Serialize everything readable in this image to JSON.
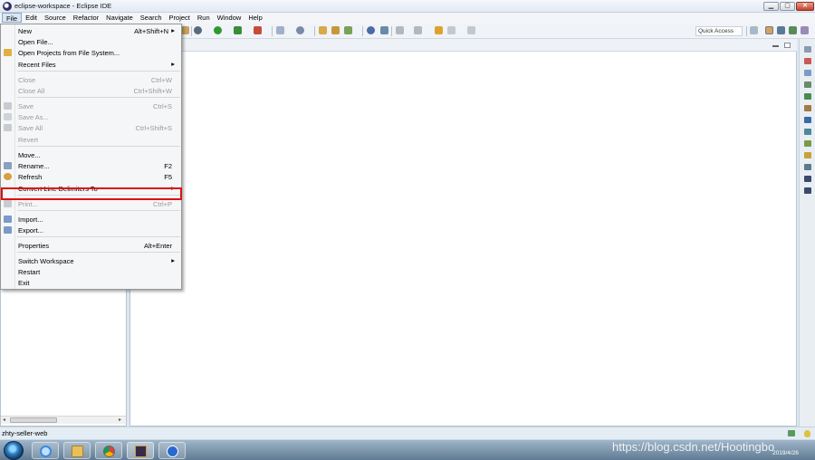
{
  "window": {
    "title": "eclipse-workspace - Eclipse IDE",
    "controls": {
      "minimize": "▁",
      "maximize": "▢",
      "close": "✕"
    }
  },
  "menubar": [
    "File",
    "Edit",
    "Source",
    "Refactor",
    "Navigate",
    "Search",
    "Project",
    "Run",
    "Window",
    "Help"
  ],
  "toolbar": {
    "quick_access": "Quick Access"
  },
  "file_menu": {
    "items": [
      {
        "label": "New",
        "shortcut": "Alt+Shift+N",
        "submenu": true,
        "enabled": true,
        "icon": ""
      },
      {
        "label": "Open File...",
        "shortcut": "",
        "submenu": false,
        "enabled": true,
        "icon": ""
      },
      {
        "label": "Open Projects from File System...",
        "shortcut": "",
        "submenu": false,
        "enabled": true,
        "icon": "folder-icon"
      },
      {
        "label": "Recent Files",
        "shortcut": "",
        "submenu": true,
        "enabled": true,
        "icon": ""
      },
      {
        "label": "Close",
        "shortcut": "Ctrl+W",
        "submenu": false,
        "enabled": false,
        "icon": ""
      },
      {
        "label": "Close All",
        "shortcut": "Ctrl+Shift+W",
        "submenu": false,
        "enabled": false,
        "icon": ""
      },
      {
        "label": "Save",
        "shortcut": "Ctrl+S",
        "submenu": false,
        "enabled": false,
        "icon": "save-icon"
      },
      {
        "label": "Save As...",
        "shortcut": "",
        "submenu": false,
        "enabled": false,
        "icon": "save-as-icon"
      },
      {
        "label": "Save All",
        "shortcut": "Ctrl+Shift+S",
        "submenu": false,
        "enabled": false,
        "icon": "save-all-icon"
      },
      {
        "label": "Revert",
        "shortcut": "",
        "submenu": false,
        "enabled": false,
        "icon": ""
      },
      {
        "label": "Move...",
        "shortcut": "",
        "submenu": false,
        "enabled": true,
        "icon": ""
      },
      {
        "label": "Rename...",
        "shortcut": "F2",
        "submenu": false,
        "enabled": true,
        "icon": "rename-icon"
      },
      {
        "label": "Refresh",
        "shortcut": "F5",
        "submenu": false,
        "enabled": true,
        "icon": "refresh-icon"
      },
      {
        "label": "Convert Line Delimiters To",
        "shortcut": "",
        "submenu": true,
        "enabled": true,
        "icon": ""
      },
      {
        "label": "Print...",
        "shortcut": "Ctrl+P",
        "submenu": false,
        "enabled": false,
        "icon": "print-icon"
      },
      {
        "label": "Import...",
        "shortcut": "",
        "submenu": false,
        "enabled": true,
        "icon": "import-icon"
      },
      {
        "label": "Export...",
        "shortcut": "",
        "submenu": false,
        "enabled": true,
        "icon": "export-icon"
      },
      {
        "label": "Properties",
        "shortcut": "Alt+Enter",
        "submenu": false,
        "enabled": true,
        "icon": ""
      },
      {
        "label": "Switch Workspace",
        "shortcut": "",
        "submenu": true,
        "enabled": true,
        "icon": ""
      },
      {
        "label": "Restart",
        "shortcut": "",
        "submenu": false,
        "enabled": true,
        "icon": ""
      },
      {
        "label": "Exit",
        "shortcut": "",
        "submenu": false,
        "enabled": true,
        "icon": ""
      }
    ]
  },
  "statusbar": {
    "text": "zhty-seller-web"
  },
  "taskbar": {
    "watermark": "https://blog.csdn.net/Hootingbo",
    "clock": "2019/4/26"
  }
}
